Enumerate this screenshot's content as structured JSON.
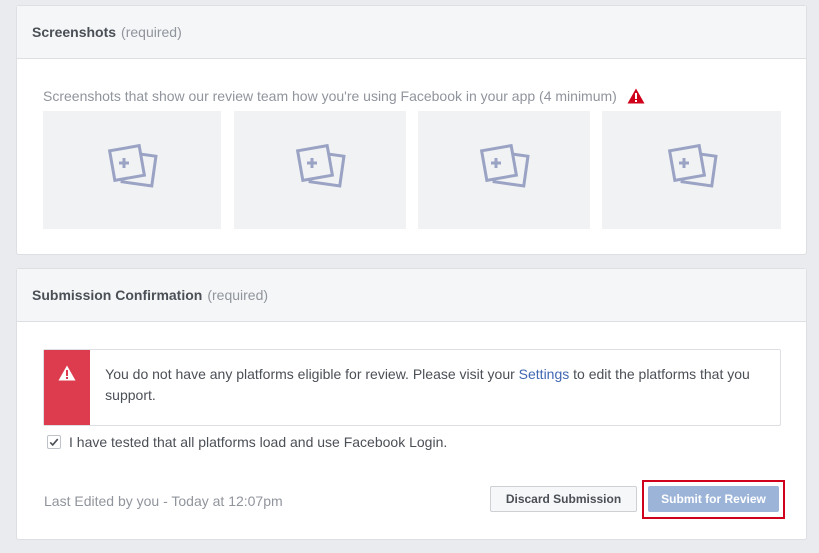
{
  "screenshots": {
    "title": "Screenshots",
    "required": "(required)",
    "caption": "Screenshots that show our review team how you're using Facebook in your app (4 minimum)",
    "warning_icon": "warning-triangle-icon",
    "slots": [
      {
        "icon": "add-photo-icon"
      },
      {
        "icon": "add-photo-icon"
      },
      {
        "icon": "add-photo-icon"
      },
      {
        "icon": "add-photo-icon"
      }
    ]
  },
  "confirmation": {
    "title": "Submission Confirmation",
    "required": "(required)",
    "alert": {
      "icon": "warning-icon",
      "text_before": "You do not have any platforms eligible for review. Please visit your ",
      "link": "Settings",
      "text_after": " to edit the platforms that you support."
    },
    "checkbox": {
      "checked": true,
      "label": "I have tested that all platforms load and use Facebook Login."
    },
    "last_edited": "Last Edited by you - Today at 12:07pm",
    "discard_label": "Discard Submission",
    "submit_label": "Submit for Review"
  },
  "colors": {
    "alert_red": "#dd3c4e",
    "link_blue": "#4267b2",
    "submit_disabled": "#9cb4d8",
    "highlight_red": "#d0021b"
  }
}
